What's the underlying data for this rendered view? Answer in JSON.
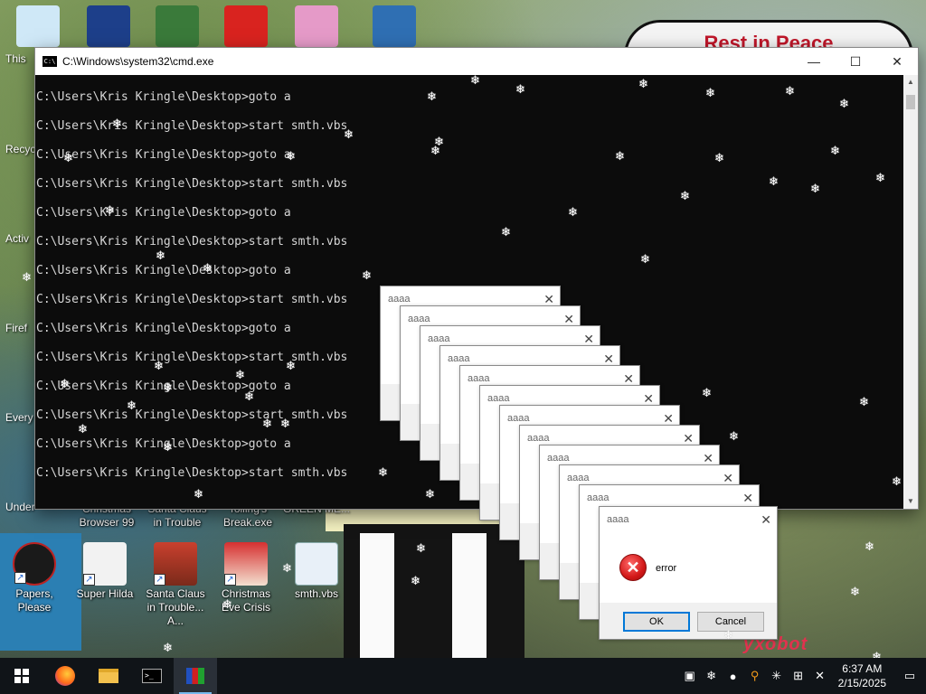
{
  "desktop": {
    "scene_text": {
      "rip": "Rest in Peace",
      "sign": "ухоbot"
    },
    "top_icons": [
      {
        "name": "this-pc-icon",
        "color": "#cfe8f7"
      },
      {
        "name": "app-icon",
        "color": "#1d3f8a"
      },
      {
        "name": "cartoon-character-icon",
        "color": "#3a7a3a"
      },
      {
        "name": "mcdonalds-icon",
        "color": "#d9231f"
      },
      {
        "name": "pig-cartoon-icon",
        "color": "#e59ac8"
      },
      {
        "name": "gear-tree-icon",
        "color": "#2f6fb3"
      }
    ],
    "side_labels": [
      "This",
      "Recyc",
      "Activ",
      "Firef",
      "Every",
      "Under"
    ],
    "partial_labels": [
      "Christmas Browser 99",
      "Santa Claus in Trouble",
      "Tolling's Break.exe",
      "GREEN ME..."
    ],
    "icons": [
      {
        "label": "Papers, Please",
        "name": "papers-please-icon",
        "color": "#1a1a1a"
      },
      {
        "label": "Super Hilda",
        "name": "super-hilda-icon",
        "color": "#f2f2f2"
      },
      {
        "label": "Santa Claus in Trouble... A...",
        "name": "santa-claus-icon",
        "color": "#c9402e"
      },
      {
        "label": "Christmas Eve Crisis",
        "name": "christmas-eve-icon",
        "color": "#d63030"
      },
      {
        "label": "smth.vbs",
        "name": "vbs-script-icon",
        "color": "#e8f0f8"
      }
    ]
  },
  "cmd": {
    "title": "C:\\Windows\\system32\\cmd.exe",
    "icon_text": "C:\\",
    "controls": {
      "minimize": "—",
      "maximize": "☐",
      "close": "✕"
    },
    "lines": [
      "C:\\Users\\Kris Kringle\\Desktop>goto a",
      "C:\\Users\\Kris Kringle\\Desktop>start smth.vbs",
      "C:\\Users\\Kris Kringle\\Desktop>goto a",
      "C:\\Users\\Kris Kringle\\Desktop>start smth.vbs",
      "C:\\Users\\Kris Kringle\\Desktop>goto a",
      "C:\\Users\\Kris Kringle\\Desktop>start smth.vbs",
      "C:\\Users\\Kris Kringle\\Desktop>goto a",
      "C:\\Users\\Kris Kringle\\Desktop>start smth.vbs",
      "C:\\Users\\Kris Kringle\\Desktop>goto a",
      "C:\\Users\\Kris Kringle\\Desktop>start smth.vbs",
      "C:\\Users\\Kris Kringle\\Desktop>goto a",
      "C:\\Users\\Kris Kringle\\Desktop>start smth.vbs",
      "C:\\Users\\Kris Kringle\\Desktop>goto a",
      "C:\\Users\\Kris Kringle\\Desktop>start smth.vbs"
    ]
  },
  "msgbox": {
    "title": "aaaa",
    "message": "error",
    "ok": "OK",
    "cancel": "Cancel",
    "close": "✕",
    "stack_count": 12
  },
  "taskbar": {
    "start_icon": "windows-logo",
    "apps": [
      "firefox-icon",
      "file-explorer-icon",
      "command-prompt-icon",
      "script-host-icon"
    ],
    "time": "6:37 AM",
    "date": "2/15/2025",
    "tray": [
      "tray-app-icon",
      "tray-snow-icon",
      "tray-drop-icon",
      "tray-search-icon",
      "tray-star-icon",
      "network-icon",
      "volume-muted-icon"
    ]
  }
}
